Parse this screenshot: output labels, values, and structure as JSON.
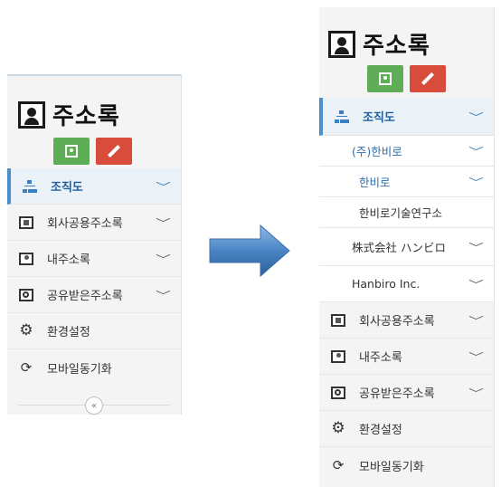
{
  "left_panel": {
    "brand_title": "주소록",
    "menu": {
      "org_chart": "조직도",
      "company_shared": "회사공용주소록",
      "my_contacts": "내주소록",
      "shared_received": "공유받은주소록",
      "settings": "환경설정",
      "mobile_sync": "모바일동기화"
    },
    "collapse_icon": "«"
  },
  "right_panel": {
    "brand_title": "주소록",
    "menu": {
      "org_chart": "조직도",
      "org_items": [
        "(주)한비로",
        "한비로",
        "한비로기술연구소",
        "株式会社 ハンビロ",
        "Hanbiro Inc."
      ],
      "company_shared": "회사공용주소록",
      "my_contacts": "내주소록",
      "shared_received": "공유받은주소록",
      "settings": "환경설정",
      "mobile_sync": "모바일동기화"
    }
  },
  "icons": {
    "chevron": "﹀",
    "settings": "⚙",
    "sync": "⟳"
  },
  "colors": {
    "active": "#1f5f9f",
    "green_button": "#5fad56",
    "red_button": "#d84c3c",
    "arrow": "#4a84c4"
  }
}
